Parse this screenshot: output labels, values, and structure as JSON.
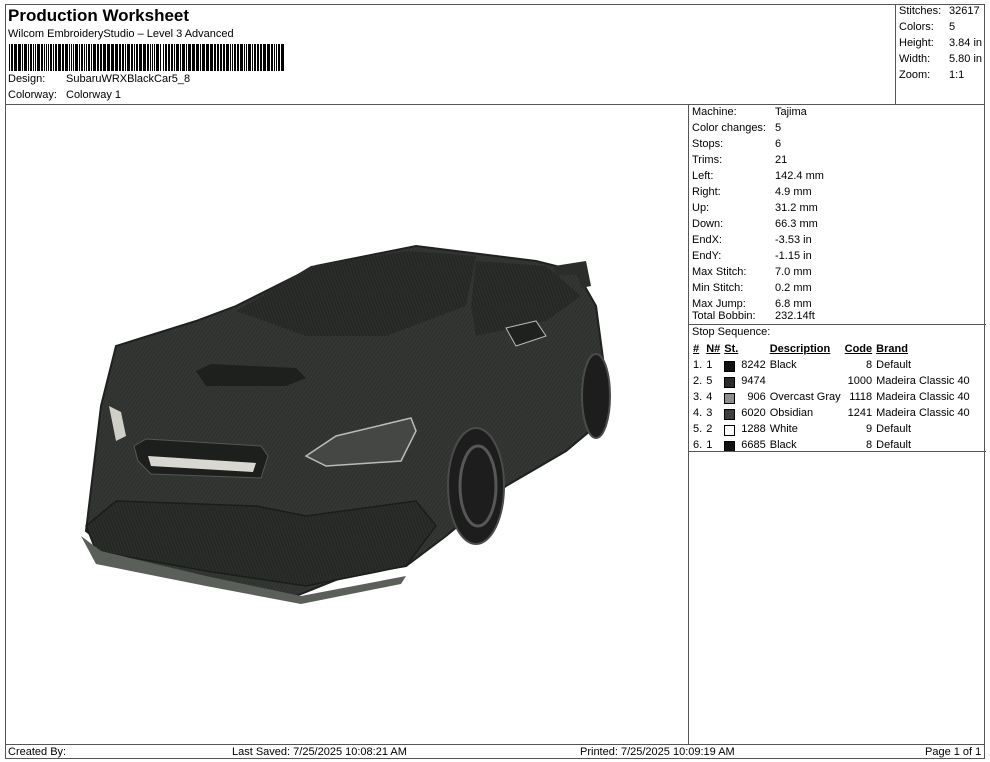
{
  "header": {
    "title": "Production Worksheet",
    "subtitle": "Wilcom EmbroideryStudio – Level 3 Advanced",
    "design_label": "Design:",
    "design_value": "SubaruWRXBlackCar5_8",
    "colorway_label": "Colorway:",
    "colorway_value": "Colorway 1"
  },
  "summary": [
    {
      "label": "Stitches:",
      "value": "32617"
    },
    {
      "label": "Colors:",
      "value": "5"
    },
    {
      "label": "Height:",
      "value": "3.84 in"
    },
    {
      "label": "Width:",
      "value": "5.80 in"
    },
    {
      "label": "Zoom:",
      "value": "1:1"
    }
  ],
  "specs": [
    {
      "label": "Machine:",
      "value": "Tajima"
    },
    {
      "label": "Color changes:",
      "value": "5"
    },
    {
      "label": "Stops:",
      "value": "6"
    },
    {
      "label": "Trims:",
      "value": "21"
    },
    {
      "label": "Left:",
      "value": "142.4 mm"
    },
    {
      "label": "Right:",
      "value": "4.9 mm"
    },
    {
      "label": "Up:",
      "value": "31.2 mm"
    },
    {
      "label": "Down:",
      "value": "66.3 mm"
    },
    {
      "label": "EndX:",
      "value": "-3.53 in"
    },
    {
      "label": "EndY:",
      "value": "-1.15 in"
    },
    {
      "label": "Max Stitch:",
      "value": "7.0 mm"
    },
    {
      "label": "Min Stitch:",
      "value": "0.2 mm"
    },
    {
      "label": "Max Jump:",
      "value": "6.8 mm"
    },
    {
      "label": "Total Bobbin:",
      "value": "232.14ft"
    }
  ],
  "stop_sequence": {
    "title": "Stop Sequence:",
    "columns": [
      "#",
      "N#",
      "St.",
      "Description",
      "Code",
      "Brand"
    ],
    "rows": [
      {
        "num": "1.",
        "n": "1",
        "color": "#111111",
        "stitches": "8242",
        "description": "Black",
        "code": "8",
        "brand": "Default"
      },
      {
        "num": "2.",
        "n": "5",
        "color": "#2b2b2b",
        "stitches": "9474",
        "description": "",
        "code": "1000",
        "brand": "Madeira Classic 40"
      },
      {
        "num": "3.",
        "n": "4",
        "color": "#8c8c8c",
        "stitches": "906",
        "description": "Overcast Gray",
        "code": "1118",
        "brand": "Madeira Classic 40"
      },
      {
        "num": "4.",
        "n": "3",
        "color": "#3e3e3e",
        "stitches": "6020",
        "description": "Obsidian",
        "code": "1241",
        "brand": "Madeira Classic 40"
      },
      {
        "num": "5.",
        "n": "2",
        "color": "#ffffff",
        "stitches": "1288",
        "description": "White",
        "code": "9",
        "brand": "Default"
      },
      {
        "num": "6.",
        "n": "1",
        "color": "#111111",
        "stitches": "6685",
        "description": "Black",
        "code": "8",
        "brand": "Default"
      }
    ]
  },
  "footer": {
    "created_by": "Created By:",
    "last_saved": "Last Saved: 7/25/2025 10:08:21 AM",
    "printed": "Printed: 7/25/2025 10:09:19 AM",
    "page": "Page 1 of 1"
  }
}
